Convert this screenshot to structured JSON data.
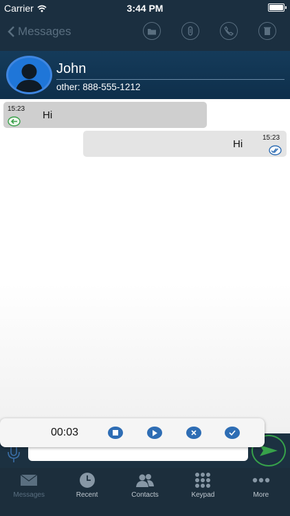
{
  "status_bar": {
    "carrier": "Carrier",
    "time": "3:44 PM"
  },
  "nav": {
    "back_label": "Messages",
    "icons": [
      "folder-icon",
      "attachment-icon",
      "phone-icon",
      "trash-icon"
    ]
  },
  "contact": {
    "name": "John",
    "phone": "other: 888-555-1212"
  },
  "messages": [
    {
      "direction": "incoming",
      "time": "15:23",
      "text": "Hi",
      "status_icon": "incoming-arrow-icon"
    },
    {
      "direction": "outgoing",
      "time": "15:23",
      "text": "Hi",
      "status_icon": "double-check-icon"
    }
  ],
  "recorder": {
    "elapsed": "00:03",
    "buttons": [
      "stop-icon",
      "play-icon",
      "cancel-icon",
      "confirm-icon"
    ]
  },
  "tabs": [
    {
      "label": "Messages",
      "icon": "envelope-icon",
      "active": true
    },
    {
      "label": "Recent",
      "icon": "clock-icon",
      "active": false
    },
    {
      "label": "Contacts",
      "icon": "contacts-icon",
      "active": false
    },
    {
      "label": "Keypad",
      "icon": "keypad-icon",
      "active": false
    },
    {
      "label": "More",
      "icon": "more-icon",
      "active": false
    }
  ],
  "colors": {
    "accent": "#2e6db4",
    "send": "#37a24a",
    "header": "#153b5a",
    "bar": "#1b2f40"
  }
}
